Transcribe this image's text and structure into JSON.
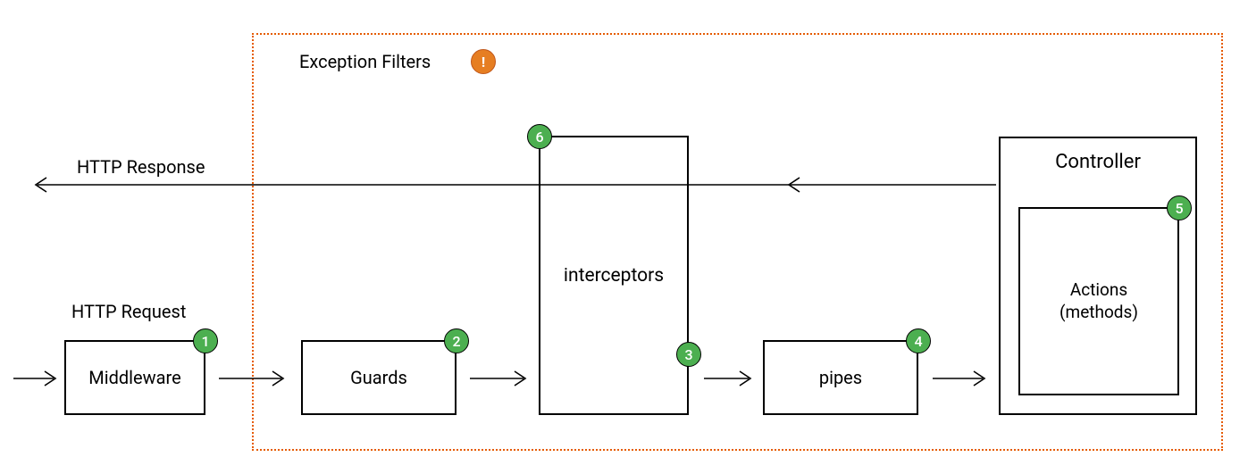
{
  "labels": {
    "http_request": "HTTP Request",
    "http_response": "HTTP Response",
    "exception_filters": "Exception Filters"
  },
  "boxes": {
    "middleware": "Middleware",
    "guards": "Guards",
    "interceptors": "interceptors",
    "pipes": "pipes",
    "controller": "Controller",
    "actions_line1": "Actions",
    "actions_line2": "(methods)"
  },
  "badges": {
    "b1": "1",
    "b2": "2",
    "b3": "3",
    "b4": "4",
    "b5": "5",
    "b6": "6",
    "warn": "!"
  }
}
